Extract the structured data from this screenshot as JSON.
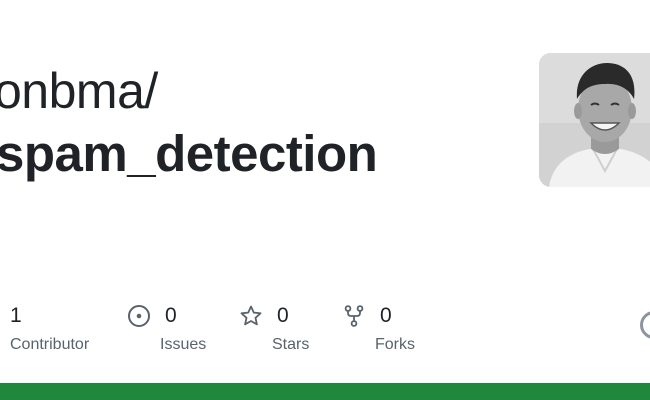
{
  "repo_card": {
    "owner": "onbma/",
    "name": "spam_detection"
  },
  "stats": {
    "contributors": {
      "count": "1",
      "label": "Contributor"
    },
    "issues": {
      "count": "0",
      "label": "Issues"
    },
    "stars": {
      "count": "0",
      "label": "Stars"
    },
    "forks": {
      "count": "0",
      "label": "Forks"
    }
  },
  "colors": {
    "text": "#1f2328",
    "muted": "#59636e",
    "icon": "#59636e",
    "bottom_bar": "#1f883d"
  },
  "icons": {
    "issues": "issue-opened-icon",
    "stars": "star-icon",
    "forks": "repo-forked-icon",
    "partial": "github-logo-icon"
  }
}
